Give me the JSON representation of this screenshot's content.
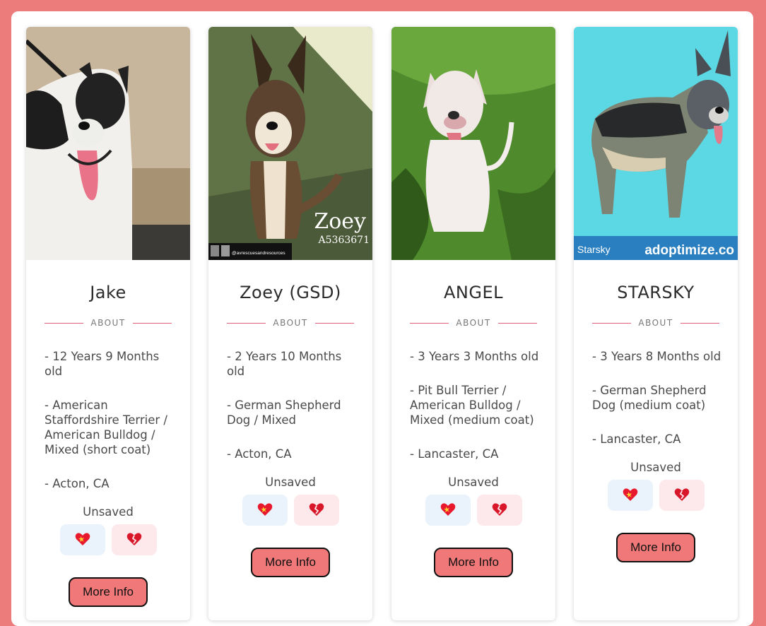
{
  "cards": [
    {
      "name": "Jake",
      "about_label": "ABOUT",
      "facts": [
        "- 12 Years 9 Months old",
        "- American Staffordshire Terrier / American Bulldog / Mixed (short coat)",
        "- Acton, CA"
      ],
      "status": "Unsaved",
      "more_label": "More Info"
    },
    {
      "name": "Zoey (GSD)",
      "about_label": "ABOUT",
      "facts": [
        "- 2 Years 10 Months old",
        "- German Shepherd Dog / Mixed",
        "- Acton, CA"
      ],
      "status": "Unsaved",
      "more_label": "More Info",
      "photo_overlay": {
        "name": "Zoey",
        "id": "A5363671",
        "handle": "@avrescuesandresources"
      }
    },
    {
      "name": "ANGEL",
      "about_label": "ABOUT",
      "facts": [
        "- 3 Years 3 Months old",
        "- Pit Bull Terrier / American Bulldog / Mixed (medium coat)",
        "- Lancaster, CA"
      ],
      "status": "Unsaved",
      "more_label": "More Info"
    },
    {
      "name": "STARSKY",
      "about_label": "ABOUT",
      "facts": [
        "- 3 Years 8 Months old",
        "- German Shepherd Dog (medium coat)",
        "- Lancaster, CA"
      ],
      "status": "Unsaved",
      "more_label": "More Info",
      "photo_overlay": {
        "name": "Starsky",
        "brand": "adoptimize.co"
      }
    }
  ],
  "icons": {
    "save": "sparkling-heart-icon",
    "unsave": "broken-heart-icon"
  },
  "colors": {
    "background": "#ec7c7c",
    "accent_line": "#e0607a",
    "button": "#f07878",
    "save_bg": "#eaf3fb",
    "unsave_bg": "#fde8ec"
  }
}
